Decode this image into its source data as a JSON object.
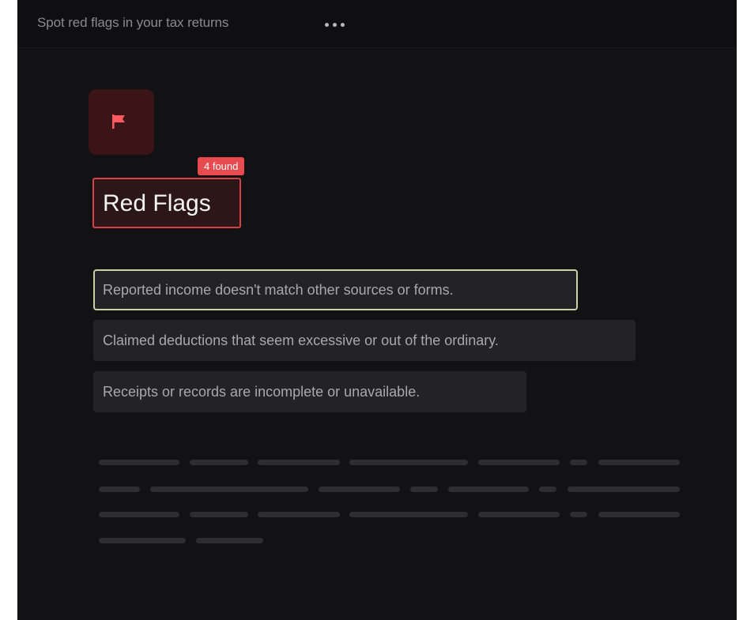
{
  "header": {
    "title": "Spot red flags in your tax returns",
    "more_icon": "more-horizontal-icon"
  },
  "section": {
    "icon": "flag-icon",
    "badge": "4 found",
    "title": "Red Flags"
  },
  "flags": [
    {
      "text": "Reported income doesn't match other sources or forms."
    },
    {
      "text": "Claimed deductions that seem excessive or out of the ordinary."
    },
    {
      "text": "Receipts or records are incomplete or unavailable."
    }
  ],
  "colors": {
    "background": "#121214",
    "accent_red": "#e84b4f",
    "flag_tile": "#3a1416",
    "selected_outline": "#c9d0a5"
  }
}
